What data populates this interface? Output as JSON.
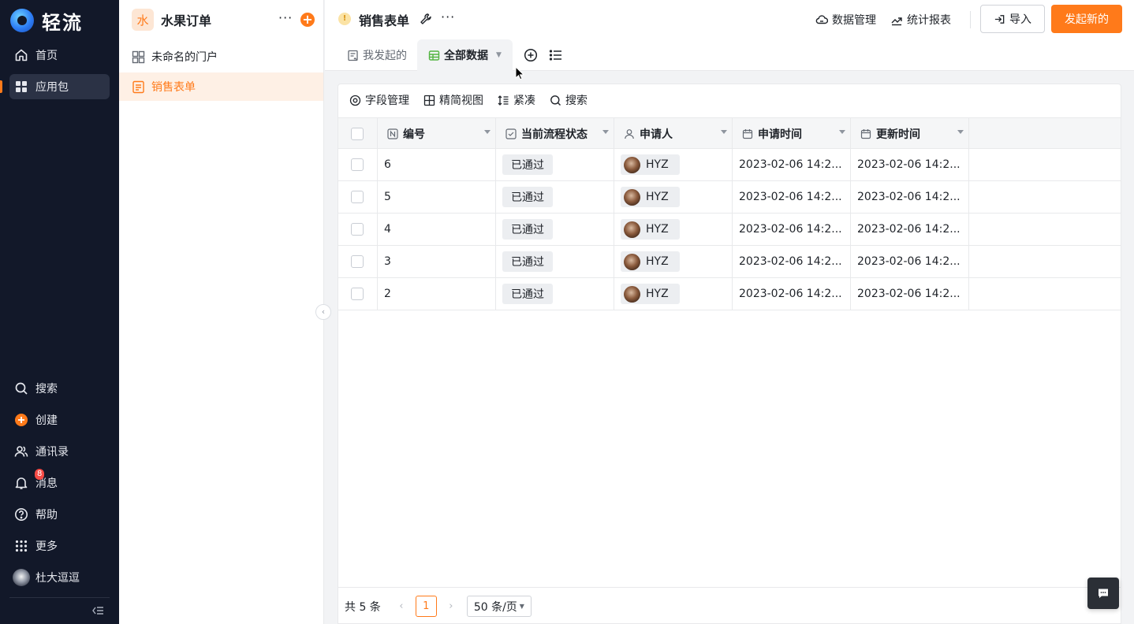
{
  "nav": {
    "logo_text": "轻流",
    "items": [
      {
        "label": "首页",
        "icon": "home-icon"
      },
      {
        "label": "应用包",
        "icon": "apps-icon"
      }
    ],
    "bottom_items": [
      {
        "label": "搜索",
        "icon": "search-icon"
      },
      {
        "label": "创建",
        "icon": "create-plus-icon"
      },
      {
        "label": "通讯录",
        "icon": "contacts-icon"
      },
      {
        "label": "消息",
        "icon": "bell-icon",
        "badge": "8"
      },
      {
        "label": "帮助",
        "icon": "help-icon"
      },
      {
        "label": "更多",
        "icon": "grid-more-icon"
      }
    ],
    "user_name": "杜大逗逗"
  },
  "sidebar": {
    "package_icon_char": "水",
    "package_title": "水果订单",
    "items": [
      {
        "label": "未命名的门户",
        "icon": "portal-icon"
      },
      {
        "label": "销售表单",
        "icon": "form-icon"
      }
    ]
  },
  "topbar": {
    "form_title": "销售表单",
    "data_manage": "数据管理",
    "reports": "统计报表",
    "import": "导入",
    "new_submit": "发起新的"
  },
  "tabs": {
    "my_started": "我发起的",
    "all_data": "全部数据"
  },
  "toolbar": {
    "fields": "字段管理",
    "simple_view": "精简视图",
    "compact": "紧凑",
    "search": "搜索"
  },
  "table": {
    "columns": [
      {
        "label": "编号",
        "icon": "number-field-icon"
      },
      {
        "label": "当前流程状态",
        "icon": "checkbox-status-icon"
      },
      {
        "label": "申请人",
        "icon": "person-icon"
      },
      {
        "label": "申请时间",
        "icon": "calendar-icon"
      },
      {
        "label": "更新时间",
        "icon": "calendar-icon"
      }
    ],
    "rows": [
      {
        "id": "6",
        "status": "已通过",
        "applicant": "HYZ",
        "applied_at": "2023-02-06 14:2...",
        "updated_at": "2023-02-06 14:2..."
      },
      {
        "id": "5",
        "status": "已通过",
        "applicant": "HYZ",
        "applied_at": "2023-02-06 14:2...",
        "updated_at": "2023-02-06 14:2..."
      },
      {
        "id": "4",
        "status": "已通过",
        "applicant": "HYZ",
        "applied_at": "2023-02-06 14:2...",
        "updated_at": "2023-02-06 14:2..."
      },
      {
        "id": "3",
        "status": "已通过",
        "applicant": "HYZ",
        "applied_at": "2023-02-06 14:2...",
        "updated_at": "2023-02-06 14:2..."
      },
      {
        "id": "2",
        "status": "已通过",
        "applicant": "HYZ",
        "applied_at": "2023-02-06 14:2...",
        "updated_at": "2023-02-06 14:2..."
      }
    ]
  },
  "pagination": {
    "total": "共 5 条",
    "current_page": "1",
    "page_size": "50 条/页"
  },
  "colors": {
    "accent": "#ff7a1a",
    "nav_bg": "#121829",
    "badge": "#f54a45"
  }
}
